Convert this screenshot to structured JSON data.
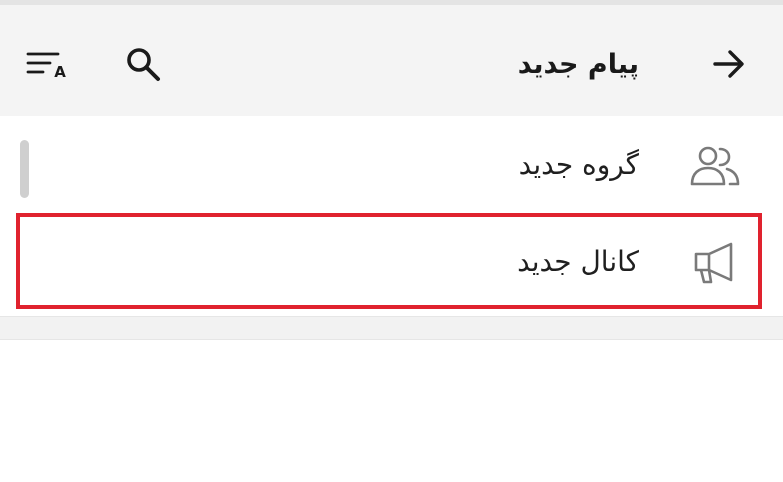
{
  "header": {
    "title": "پیام جدید",
    "back_icon": "arrow-right-icon",
    "search_icon": "search-icon",
    "sort_icon": "sort-alpha-icon",
    "sort_letter": "A"
  },
  "menu": {
    "items": [
      {
        "label": "گروه جدید",
        "icon": "people-icon"
      },
      {
        "label": "کانال جدید",
        "icon": "megaphone-icon"
      }
    ]
  },
  "colors": {
    "header_bg": "#f4f4f4",
    "highlight": "#e0222e",
    "icon_gray": "#7a7a7a",
    "icon_dark": "#1a1a1a"
  }
}
